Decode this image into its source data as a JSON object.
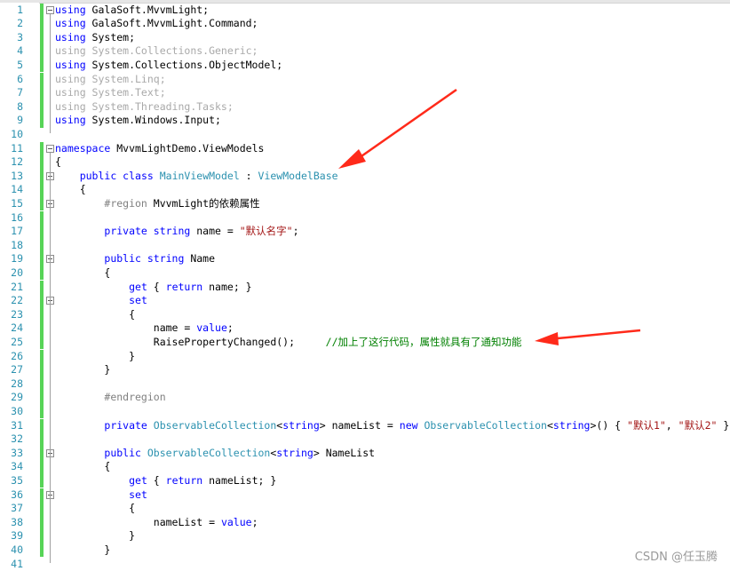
{
  "colors": {
    "keyword": "#0000ff",
    "type": "#2b91af",
    "string": "#a31515",
    "comment": "#008000",
    "unused_using": "#a9a9a9",
    "line_number": "#2b91af",
    "change_bar": "#57d457",
    "arrow": "#ff2a1a"
  },
  "watermark": "CSDN @任玉腾",
  "lines": [
    {
      "n": "1",
      "fold": true,
      "segs": [
        [
          "kw",
          "using"
        ],
        [
          "",
          "GalaSoft.MvvmLight;"
        ]
      ]
    },
    {
      "n": "2",
      "segs": [
        [
          "kw",
          "using"
        ],
        [
          "",
          "GalaSoft.MvvmLight.Command;"
        ]
      ]
    },
    {
      "n": "3",
      "segs": [
        [
          "kw",
          "using"
        ],
        [
          "",
          "System;"
        ]
      ]
    },
    {
      "n": "4",
      "segs": [
        [
          "dim",
          "using System.Collections.Generic;"
        ]
      ]
    },
    {
      "n": "5",
      "segs": [
        [
          "kw",
          "using"
        ],
        [
          "",
          "System.Collections.ObjectModel;"
        ]
      ]
    },
    {
      "n": "6",
      "segs": [
        [
          "dim",
          "using System.Linq;"
        ]
      ]
    },
    {
      "n": "7",
      "segs": [
        [
          "dim",
          "using System.Text;"
        ]
      ]
    },
    {
      "n": "8",
      "segs": [
        [
          "dim",
          "using System.Threading.Tasks;"
        ]
      ]
    },
    {
      "n": "9",
      "segs": [
        [
          "kw",
          "using"
        ],
        [
          "",
          "System.Windows.Input;"
        ]
      ]
    },
    {
      "n": "10",
      "segs": []
    },
    {
      "n": "11",
      "fold": true,
      "segs": [
        [
          "kw",
          "namespace"
        ],
        [
          "",
          "MvvmLightDemo.ViewModels"
        ]
      ]
    },
    {
      "n": "12",
      "segs": [
        [
          "",
          "{"
        ]
      ]
    },
    {
      "n": "13",
      "fold": true,
      "segs": [
        [
          "",
          "    "
        ],
        [
          "kw",
          "public class"
        ],
        [
          "",
          ""
        ],
        [
          "type",
          "MainViewModel"
        ],
        [
          "",
          " : "
        ],
        [
          "type",
          "ViewModelBase"
        ]
      ]
    },
    {
      "n": "14",
      "segs": [
        [
          "",
          "    {"
        ]
      ]
    },
    {
      "n": "15",
      "fold": true,
      "segs": [
        [
          "",
          "        "
        ],
        [
          "pp",
          "#region"
        ],
        [
          "",
          "MvvmLight的依赖属性"
        ]
      ]
    },
    {
      "n": "16",
      "segs": []
    },
    {
      "n": "17",
      "segs": [
        [
          "",
          "        "
        ],
        [
          "kw",
          "private string"
        ],
        [
          "",
          "name = "
        ],
        [
          "str",
          "\"默认名字\""
        ],
        [
          "",
          ";"
        ]
      ]
    },
    {
      "n": "18",
      "segs": []
    },
    {
      "n": "19",
      "fold": true,
      "segs": [
        [
          "",
          "        "
        ],
        [
          "kw",
          "public string"
        ],
        [
          "",
          "Name"
        ]
      ]
    },
    {
      "n": "20",
      "segs": [
        [
          "",
          "        {"
        ]
      ]
    },
    {
      "n": "21",
      "segs": [
        [
          "",
          "            "
        ],
        [
          "kw",
          "get"
        ],
        [
          "",
          " { "
        ],
        [
          "kw",
          "return"
        ],
        [
          "",
          "name; }"
        ]
      ]
    },
    {
      "n": "22",
      "fold": true,
      "segs": [
        [
          "",
          "            "
        ],
        [
          "kw",
          "set"
        ]
      ]
    },
    {
      "n": "23",
      "segs": [
        [
          "",
          "            {"
        ]
      ]
    },
    {
      "n": "24",
      "segs": [
        [
          "",
          "                name = "
        ],
        [
          "kw",
          "value"
        ],
        [
          "",
          ";"
        ]
      ]
    },
    {
      "n": "25",
      "segs": [
        [
          "",
          "                RaisePropertyChanged();     "
        ],
        [
          "cmt",
          "//加上了这行代码，属性就具有了通知功能"
        ]
      ]
    },
    {
      "n": "26",
      "segs": [
        [
          "",
          "            }"
        ]
      ]
    },
    {
      "n": "27",
      "segs": [
        [
          "",
          "        }"
        ]
      ]
    },
    {
      "n": "28",
      "segs": []
    },
    {
      "n": "29",
      "segs": [
        [
          "",
          "        "
        ],
        [
          "pp",
          "#endregion"
        ]
      ]
    },
    {
      "n": "30",
      "segs": []
    },
    {
      "n": "31",
      "segs": [
        [
          "",
          "        "
        ],
        [
          "kw",
          "private"
        ],
        [
          "",
          " "
        ],
        [
          "type",
          "ObservableCollection"
        ],
        [
          "",
          "<"
        ],
        [
          "kw",
          "string"
        ],
        [
          "",
          "> nameList = "
        ],
        [
          "kw",
          "new"
        ],
        [
          "",
          " "
        ],
        [
          "type",
          "ObservableCollection"
        ],
        [
          "",
          "<"
        ],
        [
          "kw",
          "string"
        ],
        [
          "",
          ">() { "
        ],
        [
          "str",
          "\"默认1\""
        ],
        [
          "",
          ", "
        ],
        [
          "str",
          "\"默认2\""
        ],
        [
          "",
          " };"
        ]
      ]
    },
    {
      "n": "32",
      "segs": []
    },
    {
      "n": "33",
      "fold": true,
      "segs": [
        [
          "",
          "        "
        ],
        [
          "kw",
          "public"
        ],
        [
          "",
          " "
        ],
        [
          "type",
          "ObservableCollection"
        ],
        [
          "",
          "<"
        ],
        [
          "kw",
          "string"
        ],
        [
          "",
          "> NameList"
        ]
      ]
    },
    {
      "n": "34",
      "segs": [
        [
          "",
          "        {"
        ]
      ]
    },
    {
      "n": "35",
      "segs": [
        [
          "",
          "            "
        ],
        [
          "kw",
          "get"
        ],
        [
          "",
          " { "
        ],
        [
          "kw",
          "return"
        ],
        [
          "",
          "nameList; }"
        ]
      ]
    },
    {
      "n": "36",
      "fold": true,
      "segs": [
        [
          "",
          "            "
        ],
        [
          "kw",
          "set"
        ]
      ]
    },
    {
      "n": "37",
      "segs": [
        [
          "",
          "            {"
        ]
      ]
    },
    {
      "n": "38",
      "segs": [
        [
          "",
          "                nameList = "
        ],
        [
          "kw",
          "value"
        ],
        [
          "",
          ";"
        ]
      ]
    },
    {
      "n": "39",
      "segs": [
        [
          "",
          "            }"
        ]
      ]
    },
    {
      "n": "40",
      "segs": [
        [
          "",
          "        }"
        ]
      ]
    },
    {
      "n": "41",
      "segs": []
    }
  ]
}
